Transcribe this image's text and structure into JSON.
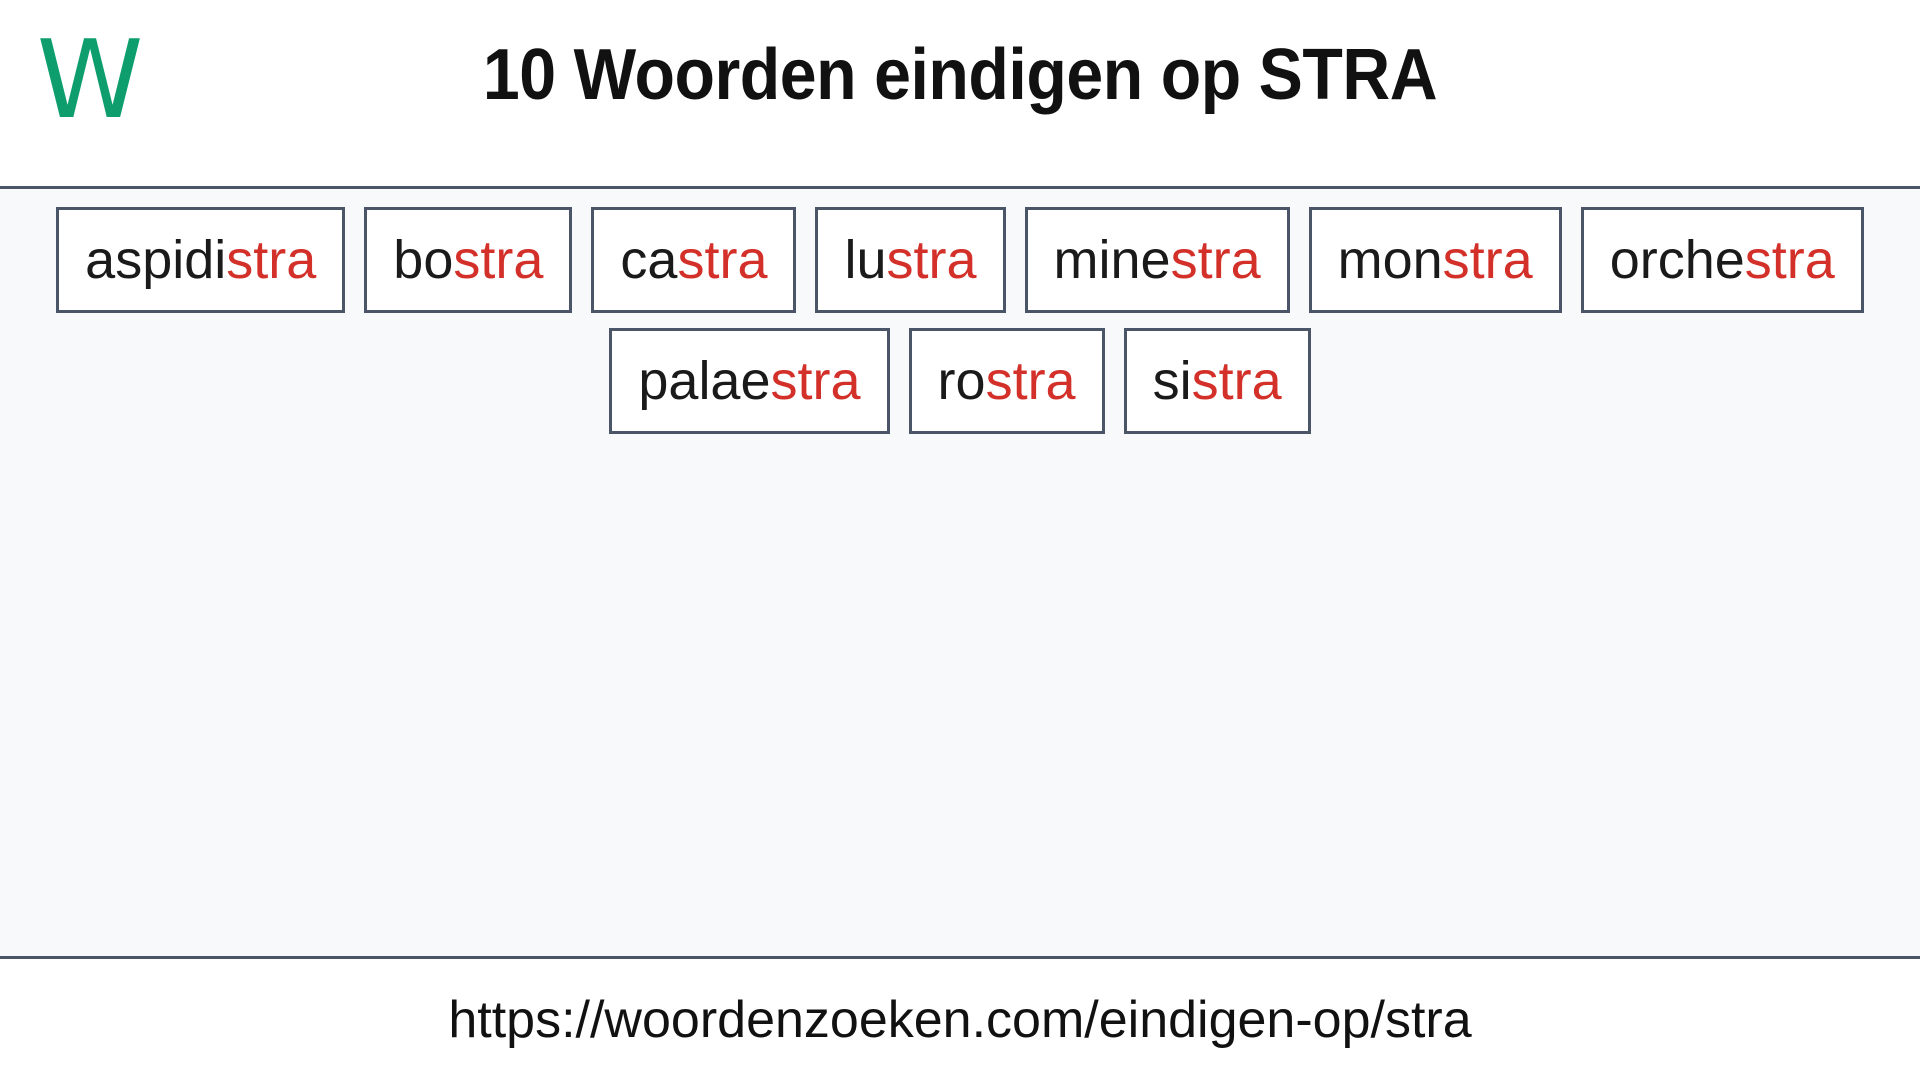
{
  "header": {
    "logo_text": "W",
    "logo_color": "#0e9e6e",
    "title": "10 Woorden eindigen op STRA"
  },
  "colors": {
    "suffix_highlight": "#d3302a",
    "box_border": "#4a5568",
    "content_background": "#f7f9fb",
    "text": "#111111"
  },
  "main": {
    "highlight_suffix": "stra",
    "rows": [
      [
        {
          "stem": "aspidi",
          "suffix": "stra",
          "full": "aspidistra"
        },
        {
          "stem": "bo",
          "suffix": "stra",
          "full": "bostra"
        },
        {
          "stem": "ca",
          "suffix": "stra",
          "full": "castra"
        },
        {
          "stem": "lu",
          "suffix": "stra",
          "full": "lustra"
        },
        {
          "stem": "mine",
          "suffix": "stra",
          "full": "minestra"
        },
        {
          "stem": "mon",
          "suffix": "stra",
          "full": "monstra"
        },
        {
          "stem": "orche",
          "suffix": "stra",
          "full": "orchestra"
        }
      ],
      [
        {
          "stem": "palae",
          "suffix": "stra",
          "full": "palaestra"
        },
        {
          "stem": "ro",
          "suffix": "stra",
          "full": "rostra"
        },
        {
          "stem": "si",
          "suffix": "stra",
          "full": "sistra"
        }
      ]
    ]
  },
  "footer": {
    "url": "https://woordenzoeken.com/eindigen-op/stra"
  }
}
